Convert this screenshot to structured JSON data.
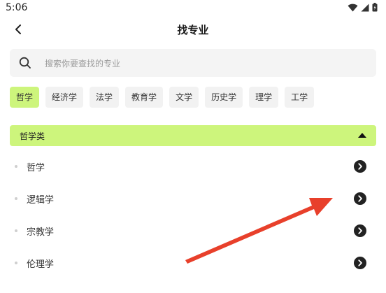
{
  "status": {
    "time": "5:06"
  },
  "header": {
    "title": "找专业"
  },
  "search": {
    "placeholder": "搜索你要查找的专业"
  },
  "tabs": [
    "哲学",
    "经济学",
    "法学",
    "教育学",
    "文学",
    "历史学",
    "理学",
    "工学"
  ],
  "active_tab": "哲学",
  "category": {
    "label": "哲学类"
  },
  "items": [
    "哲学",
    "逻辑学",
    "宗教学",
    "伦理学"
  ],
  "colors": {
    "accent": "#cdf57c",
    "annotation": "#e8402b"
  }
}
